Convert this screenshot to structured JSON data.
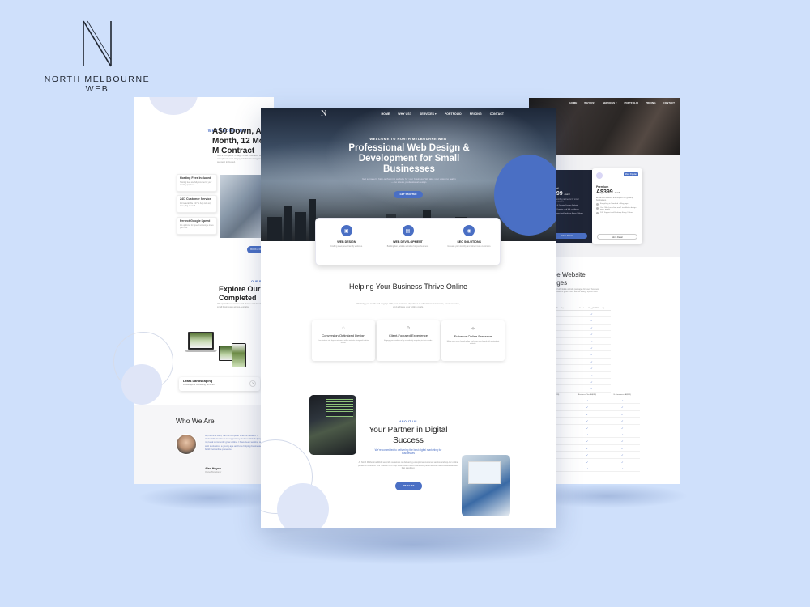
{
  "brand": {
    "logo_letter": "N",
    "name": "NORTH MELBOURNE WEB"
  },
  "colors": {
    "background": "#cfe0fb",
    "accent": "#4a6fc4",
    "dark_card": "#1f2536"
  },
  "left_page": {
    "kicker": "WHY CHOOSE US",
    "heading": "A$0 Down, A$19 Month, 12 Month M Contract",
    "subtext": "Get a complete 5-page small business website with no upfront cost. Enjoy reliable hosting and ongoing support included.",
    "features": [
      {
        "title": "Hosting Fees Included",
        "text": "Hosting fees are fully covered in your monthly payment."
      },
      {
        "title": "24/7 Customer Service",
        "text": "We're available 24/7 to help with any issue, big or small."
      },
      {
        "title": "Perfect Google Speed",
        "text": "We optimise for speed so Google loves your site."
      }
    ],
    "cta": "BOOK A FREE CALL",
    "portfolio_kicker": "OUR PORTFOLIO",
    "portfolio_heading": "Explore Our Completed",
    "portfolio_subtext": "We specialise in custom web design and development for small businesses across Australia.",
    "showcase": {
      "title": "Leafs Landscaping",
      "subtitle": "Landscape & Gardening Services",
      "arrow": "›"
    },
    "who": {
      "title": "Who We Are",
      "text": "My name is Alan, I am a computer science student. I started this business to support my studies while helping my local community grow online. I have been working with web tools since a young age and love helping businesses build their online presence.",
      "name": "Alan Huynh",
      "role": "Owner/Developer"
    }
  },
  "center_page": {
    "logo": "N",
    "nav": [
      "HOME",
      "WHY US?",
      "SERVICES ▾",
      "PORTFOLIO",
      "PRICING",
      "CONTACT"
    ],
    "hero": {
      "kicker": "WELCOME TO NORTH MELBOURNE WEB",
      "title": "Professional Web Design & Development for Small Businesses",
      "subtitle": "Get a modern, high-performing website for your business. We take your vision to reality — no stress, professional design.",
      "cta": "GET STARTED"
    },
    "services": [
      {
        "icon": "▣",
        "title": "WEB DESIGN",
        "text": "Crafting sleek, user-friendly websites."
      },
      {
        "icon": "▤",
        "title": "WEB DEVELOPMENT",
        "text": "Building fast, reliable websites for your business."
      },
      {
        "icon": "◉",
        "title": "SEO SOLUTIONS",
        "text": "Increase your visibility and attract more customers."
      }
    ],
    "section": {
      "title": "Helping Your Business Thrive Online",
      "subtitle": "We help you reach and engage with your business objectives to attract new customers, boost revenue, and achieve your online goals."
    },
    "features": [
      {
        "icon": "◌",
        "title": "Conversion-Optimized Design",
        "text": "Turn visitors into loyal customers with a website designed to drive action."
      },
      {
        "icon": "☺",
        "title": "Client-Focused Experience",
        "text": "Engage your audience by seamlessly adapting to their needs."
      },
      {
        "icon": "✧",
        "title": "Enhance Online Presence",
        "text": "Make your voice heard online and grow your brand with a standout website."
      }
    ],
    "about": {
      "kicker": "ABOUT US",
      "title": "Your Partner in Digital Success",
      "lead": "We're committed to delivering the best digital marketing for businesses",
      "text": "At North Melbourne Web, we pride ourselves on delivering exceptional customer service and top-tier online presence solutions. Our mission is to help businesses thrive online with personalized, hand-crafted websites that stand out.",
      "cta": "WHY US?"
    }
  },
  "right_page": {
    "logo": "N",
    "nav": [
      "HOME",
      "WHY US?",
      "SERVICES ▾",
      "PORTFOLIO",
      "PRICING",
      "CONTACT"
    ],
    "plans": [
      {
        "name": "Standard",
        "price": "A$199",
        "period": "/month",
        "desc": "Affordable monthly payments for small businesses websites.",
        "features": [
          "5 Pages & Domain Custom Website",
          "Hosting, Domain, and SSL certificate",
          "24/7 Support and Bookings Every 3 Hours"
        ],
        "cta": "More Detail"
      },
      {
        "name": "Premium",
        "badge": "Most Popular",
        "price": "A$399",
        "period": "/month",
        "desc": "Enhanced features and support for growing businesses.",
        "features": [
          "Everything in Standard + Blog page",
          "One Offer Launching and 1 installation design work, month",
          "24/7 Support and Bookings Every 3 Hours"
        ],
        "cta": "More Detail"
      }
    ],
    "packages_title": "Service Website Packages",
    "packages_subtitle": "We provide a range of affordable website packages for every business, allowing small businesses to grow online without a large upfront cost.",
    "table1": {
      "headers": [
        "Standard (A$199/month)",
        "Standard + Blog (A$299/month)"
      ],
      "rows": [
        [
          "✓",
          "✓"
        ],
        [
          "✓",
          "✓"
        ],
        [
          "✓",
          "✓"
        ],
        [
          "✓",
          "✓"
        ],
        [
          "✓",
          "✓"
        ],
        [
          "✓",
          "✓"
        ],
        [
          "✓",
          "✓"
        ],
        [
          "✓",
          "✓"
        ],
        [
          "✓",
          "✓"
        ],
        [
          "✓",
          "✓"
        ],
        [
          "✓",
          "✓"
        ],
        [
          "✓",
          "✓"
        ]
      ]
    },
    "table2": {
      "headers": [
        "Business (A$499)",
        "Business Plus (A$699)",
        "E-Commerce (A$999)"
      ],
      "rows": [
        [
          "✓",
          "✓",
          "✓"
        ],
        [
          "✓",
          "✓",
          "✓"
        ],
        [
          "✓",
          "✓",
          "✓"
        ],
        [
          "✓",
          "✓",
          "✓"
        ],
        [
          "✓",
          "✓",
          "✓"
        ],
        [
          "✓",
          "✓",
          "✓"
        ],
        [
          "✓",
          "✓",
          "✓"
        ],
        [
          "✓",
          "✓",
          "✓"
        ],
        [
          "✓",
          "✓",
          "✓"
        ],
        [
          "✓",
          "✓",
          "✓"
        ],
        [
          "✓",
          "✓",
          "✓"
        ]
      ]
    }
  }
}
